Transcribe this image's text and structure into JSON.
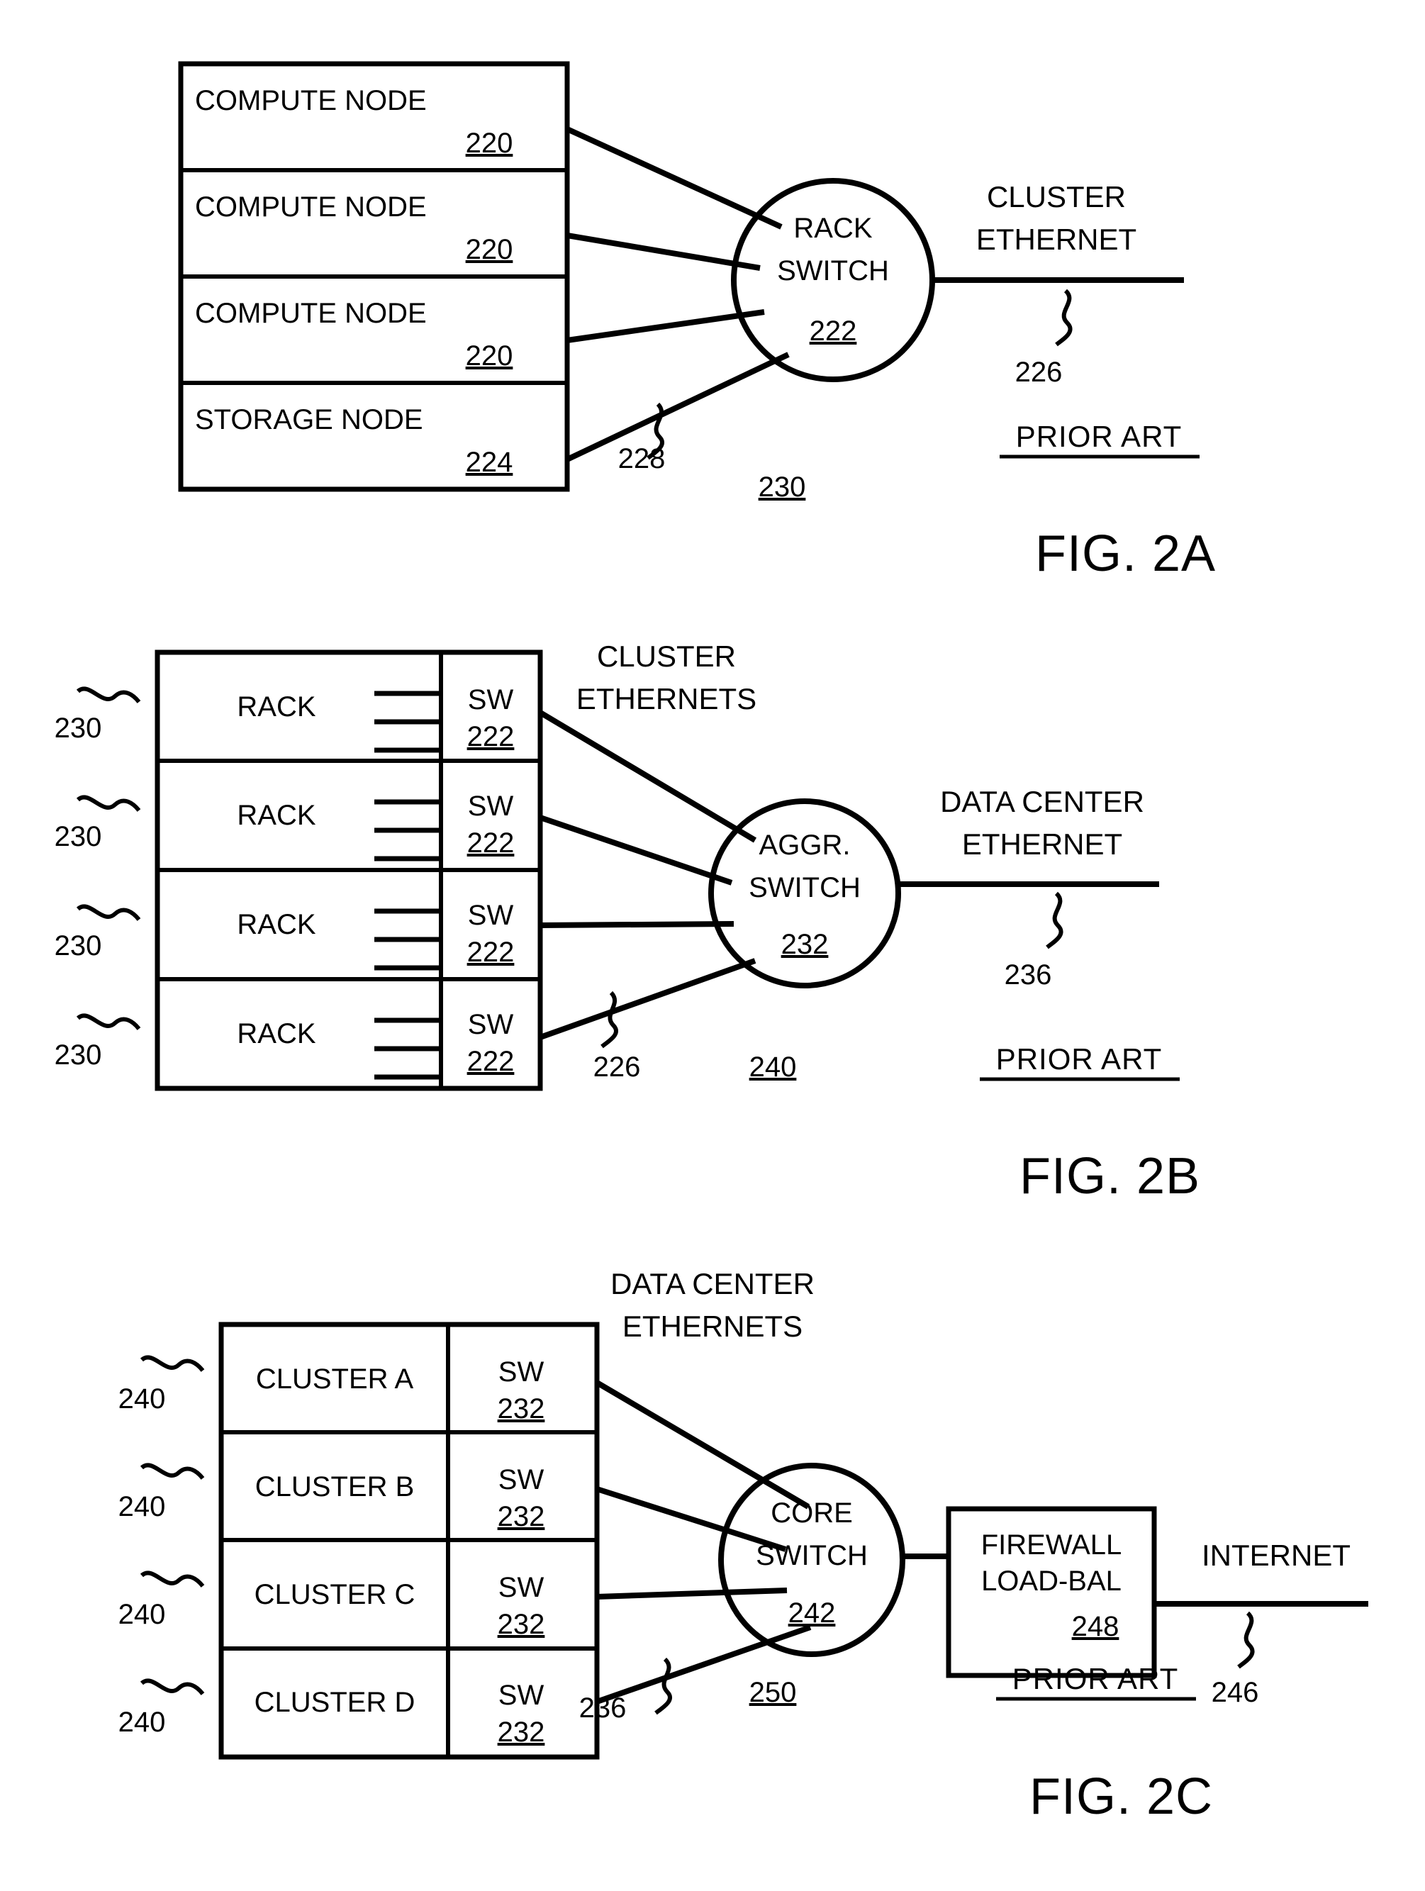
{
  "document": {
    "type": "patent-figure-sheet",
    "figures": [
      "FIG. 2A",
      "FIG. 2B",
      "FIG. 2C"
    ]
  },
  "fig2a": {
    "caption": "FIG. 2A",
    "prior_art": "PRIOR  ART",
    "nodes": [
      {
        "label": "COMPUTE NODE",
        "ref": "220"
      },
      {
        "label": "COMPUTE NODE",
        "ref": "220"
      },
      {
        "label": "COMPUTE NODE",
        "ref": "220"
      },
      {
        "label": "STORAGE NODE",
        "ref": "224"
      }
    ],
    "switch": {
      "line1": "RACK",
      "line2": "SWITCH",
      "ref": "222"
    },
    "network": {
      "label_line1": "CLUSTER",
      "label_line2": "ETHERNET",
      "ref": "226"
    },
    "link_ref": "228",
    "rack_ref": "230"
  },
  "fig2b": {
    "caption": "FIG. 2B",
    "prior_art": "PRIOR  ART",
    "rows": [
      {
        "label": "RACK",
        "sw_label": "SW",
        "sw_ref": "222",
        "side_ref": "230"
      },
      {
        "label": "RACK",
        "sw_label": "SW",
        "sw_ref": "222",
        "side_ref": "230"
      },
      {
        "label": "RACK",
        "sw_label": "SW",
        "sw_ref": "222",
        "side_ref": "230"
      },
      {
        "label": "RACK",
        "sw_label": "SW",
        "sw_ref": "222",
        "side_ref": "230"
      }
    ],
    "uplinks": {
      "label_line1": "CLUSTER",
      "label_line2": "ETHERNETS",
      "ref": "226"
    },
    "switch": {
      "line1": "AGGR.",
      "line2": "SWITCH",
      "ref": "232"
    },
    "network": {
      "label_line1": "DATA CENTER",
      "label_line2": "ETHERNET",
      "ref": "236"
    },
    "cluster_ref": "240"
  },
  "fig2c": {
    "caption": "FIG. 2C",
    "prior_art": "PRIOR  ART",
    "rows": [
      {
        "label": "CLUSTER A",
        "sw_label": "SW",
        "sw_ref": "232",
        "side_ref": "240"
      },
      {
        "label": "CLUSTER B",
        "sw_label": "SW",
        "sw_ref": "232",
        "side_ref": "240"
      },
      {
        "label": "CLUSTER C",
        "sw_label": "SW",
        "sw_ref": "232",
        "side_ref": "240"
      },
      {
        "label": "CLUSTER D",
        "sw_label": "SW",
        "sw_ref": "232",
        "side_ref": "240"
      }
    ],
    "uplinks": {
      "label_line1": "DATA CENTER",
      "label_line2": "ETHERNETS",
      "ref": "236"
    },
    "switch": {
      "line1": "CORE",
      "line2": "SWITCH",
      "ref": "242"
    },
    "firewall": {
      "line1": "FIREWALL",
      "line2": "LOAD-BAL",
      "ref": "248"
    },
    "network": {
      "label": "INTERNET",
      "ref": "246"
    },
    "datacenter_ref": "250"
  }
}
